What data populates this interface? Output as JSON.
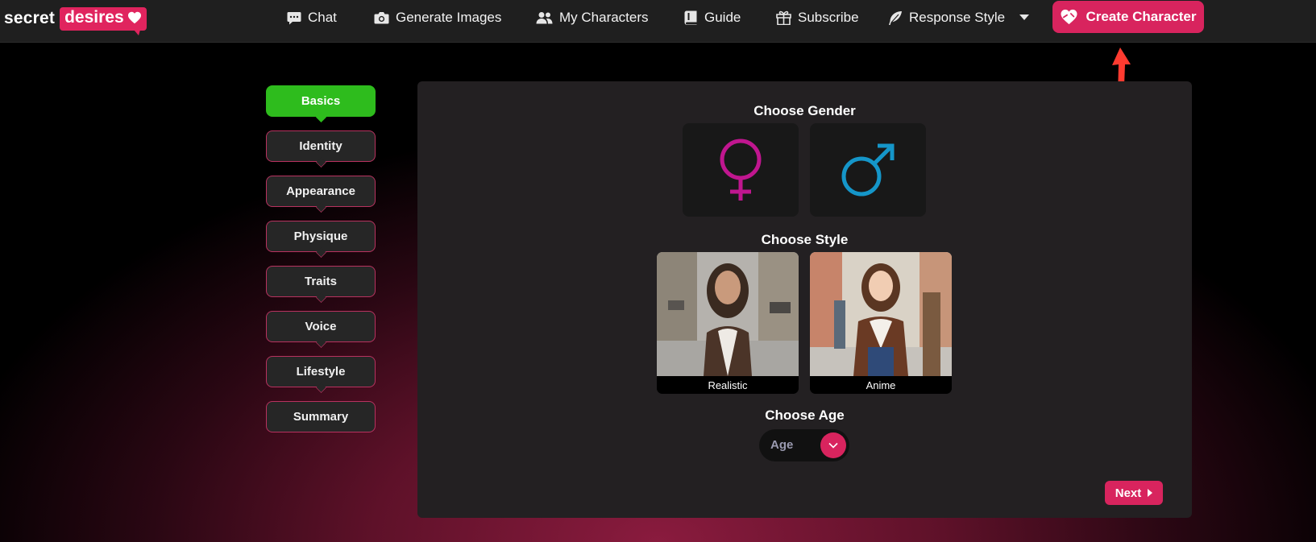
{
  "brand": {
    "part1": "secret",
    "part2": "desires"
  },
  "nav": {
    "chat": "Chat",
    "generate_images": "Generate Images",
    "my_characters": "My Characters",
    "guide": "Guide",
    "subscribe": "Subscribe",
    "response_style": "Response Style",
    "create_character": "Create Character"
  },
  "steps": [
    "Basics",
    "Identity",
    "Appearance",
    "Physique",
    "Traits",
    "Voice",
    "Lifestyle",
    "Summary"
  ],
  "active_step": "Basics",
  "main": {
    "gender_title": "Choose Gender",
    "style_title": "Choose Style",
    "style_options": [
      "Realistic",
      "Anime"
    ],
    "age_title": "Choose Age",
    "age_placeholder": "Age",
    "next_label": "Next"
  },
  "colors": {
    "accent": "#d8245e",
    "active_step": "#2ebc1d",
    "female_symbol": "#c0168f",
    "male_symbol": "#1596c9",
    "annotation_arrow": "#ff3b30"
  },
  "icons": [
    "chat-icon",
    "camera-icon",
    "users-icon",
    "book-icon",
    "gift-icon",
    "feather-icon",
    "caret-down-icon",
    "heart-icon",
    "female-icon",
    "male-icon",
    "chevron-down-icon",
    "caret-right-icon"
  ]
}
